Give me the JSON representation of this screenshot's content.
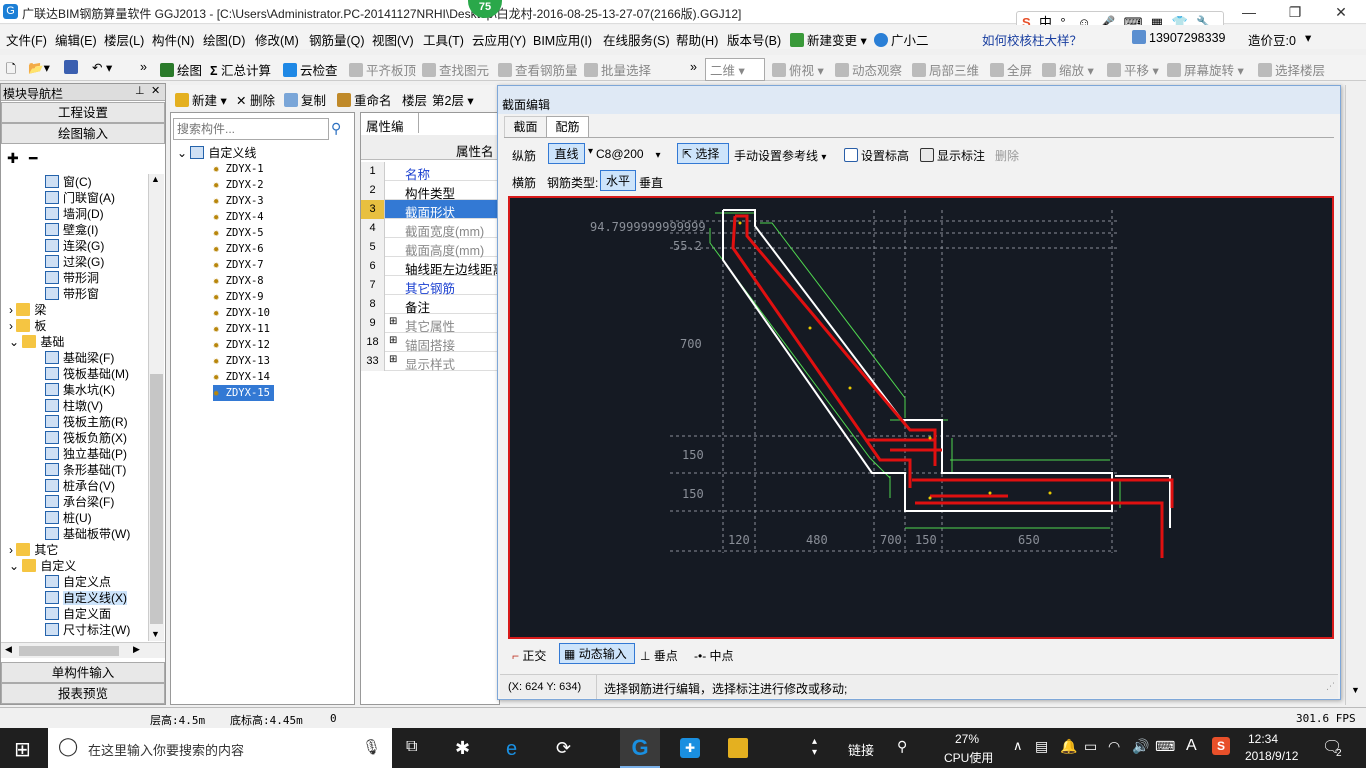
{
  "titlebar": {
    "title": "广联达BIM钢筋算量软件 GGJ2013 - [C:\\Users\\Administrator.PC-20141127NRHI\\Desktop\\白龙村-2016-08-25-13-27-07(2166版).GGJ12]",
    "badge": "75",
    "ime_text": "中",
    "phone": "13907298339",
    "price_label": "造价豆:0",
    "help_text": "如何校核柱大样？"
  },
  "menu": [
    "文件(F)",
    "编辑(E)",
    "楼层(L)",
    "构件(N)",
    "绘图(D)",
    "修改(M)",
    "钢筋量(Q)",
    "视图(V)",
    "工具(T)",
    "云应用(Y)",
    "BIM应用(I)",
    "在线服务(S)",
    "帮助(H)",
    "版本号(B)",
    "新建变更",
    "广小二"
  ],
  "toolbar1": [
    "绘图",
    "汇总计算",
    "云检查",
    "平齐板顶",
    "查找图元",
    "查看钢筋量",
    "批量选择",
    "二维",
    "俯视",
    "动态观察",
    "局部三维",
    "全屏",
    "缩放",
    "平移",
    "屏幕旋转",
    "选择楼层"
  ],
  "leftnav": {
    "title": "模块导航栏",
    "btn_eng": "工程设置",
    "btn_draw": "绘图输入",
    "btn_single": "单构件输入",
    "btn_report": "报表预览",
    "items": [
      "窗(C)",
      "门联窗(A)",
      "墙洞(D)",
      "壁龛(I)",
      "连梁(G)",
      "过梁(G)",
      "带形洞",
      "带形窗",
      "梁",
      "板",
      "基础",
      "基础梁(F)",
      "筏板基础(M)",
      "集水坑(K)",
      "柱墩(V)",
      "筏板主筋(R)",
      "筏板负筋(X)",
      "独立基础(P)",
      "条形基础(T)",
      "桩承台(V)",
      "承台梁(F)",
      "桩(U)",
      "基础板带(W)",
      "其它",
      "自定义",
      "自定义点",
      "自定义线(X)",
      "自定义面",
      "尺寸标注(W)"
    ]
  },
  "comp": {
    "toolbar": [
      "新建",
      "删除",
      "复制",
      "重命名",
      "楼层",
      "第2层"
    ],
    "search_placeholder": "搜索构件...",
    "root": "自定义线",
    "items": [
      "ZDYX-1",
      "ZDYX-2",
      "ZDYX-3",
      "ZDYX-4",
      "ZDYX-5",
      "ZDYX-6",
      "ZDYX-7",
      "ZDYX-8",
      "ZDYX-9",
      "ZDYX-10",
      "ZDYX-11",
      "ZDYX-12",
      "ZDYX-13",
      "ZDYX-14",
      "ZDYX-15"
    ]
  },
  "props": {
    "tab": "属性编辑",
    "header": "属性名",
    "rows": [
      {
        "n": "1",
        "l": "名称"
      },
      {
        "n": "2",
        "l": "构件类型"
      },
      {
        "n": "3",
        "l": "截面形状"
      },
      {
        "n": "4",
        "l": "截面宽度(mm)"
      },
      {
        "n": "5",
        "l": "截面高度(mm)"
      },
      {
        "n": "6",
        "l": "轴线距左边线距离"
      },
      {
        "n": "7",
        "l": "其它钢筋"
      },
      {
        "n": "8",
        "l": "备注"
      },
      {
        "n": "9",
        "l": "其它属性"
      },
      {
        "n": "18",
        "l": "锚固搭接"
      },
      {
        "n": "33",
        "l": "显示样式"
      }
    ]
  },
  "dialog": {
    "title": "截面编辑",
    "tabs": [
      "截面",
      "配筋"
    ],
    "row1": {
      "zongjin": "纵筋",
      "mode": "直线",
      "spec": "C8@200",
      "select": "选择",
      "manual": "手动设置参考线",
      "setmark": "设置标高",
      "showmark": "显示标注",
      "delete": "删除"
    },
    "row2": {
      "hengjin": "横筋",
      "type_label": "钢筋类型:",
      "horizontal": "水平",
      "vertical": "垂直"
    },
    "canvas": {
      "dim_top": "94.7999999999999",
      "dim_552": "55.2",
      "dim_700": "700",
      "dim_150a": "150",
      "dim_150b": "150",
      "bottom_dims": [
        "120",
        "480",
        "700",
        "150",
        "650"
      ]
    },
    "snap": [
      "正交",
      "动态输入",
      "垂点",
      "中点"
    ],
    "coord": "(X: 624 Y: 634)",
    "hint": "选择钢筋进行编辑，选择标注进行修改或移动;"
  },
  "status": {
    "floor_height": "层高:4.5m",
    "base_height": "底标高:4.45m",
    "zero": "0",
    "fps": "301.6 FPS"
  },
  "taskbar": {
    "search_placeholder": "在这里输入你要搜索的内容",
    "link": "链接",
    "cpu_pct": "27%",
    "cpu_label": "CPU使用",
    "ime_a": "A",
    "time": "12:34",
    "date": "2018/9/12",
    "notif": "2"
  },
  "colors": {
    "rebar": "#e01010",
    "outline": "#ffffff",
    "dim": "#4fd64f",
    "canvas_bg": "#151a23",
    "selected": "#3379d4"
  }
}
